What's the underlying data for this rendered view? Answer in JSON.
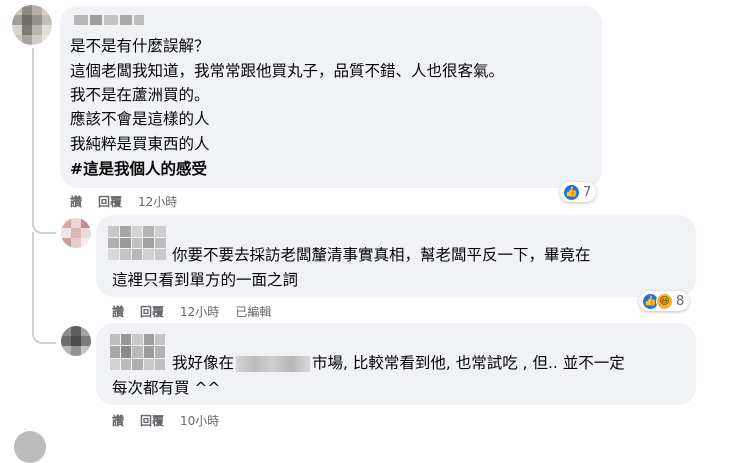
{
  "comments": [
    {
      "lines": [
        "是不是有什麼誤解？",
        "這個老闆我知道，我常常跟他買丸子，品質不錯、人也很客氣。",
        "我不是在蘆洲買的。",
        "應該不會是這樣的人",
        "我純粹是買東西的人"
      ],
      "hashtag": "#這是我個人的感受",
      "actions": {
        "like": "讚",
        "reply": "回覆",
        "time": "12小時"
      },
      "reaction_count": "7"
    },
    {
      "lines": [
        "你要不要去採訪老闆釐清事實真相，幫老闆平反一下，畢竟在",
        "這裡只看到單方的一面之詞"
      ],
      "actions": {
        "like": "讚",
        "reply": "回覆",
        "time": "12小時",
        "edited": "已編輯"
      },
      "reaction_count": "8"
    },
    {
      "line1_prefix": "我好像在",
      "line1_suffix": "市場, 比較常看到他, 也常試吃 , 但.. 並不一定",
      "line2": "每次都有買 ^^",
      "actions": {
        "like": "讚",
        "reply": "回覆",
        "time": "10小時"
      }
    }
  ],
  "icons": {
    "like": "thumbs-up-icon",
    "haha": "laughing-face-icon"
  },
  "colors": {
    "bubble": "#f0f2f5",
    "meta_text": "#65676b",
    "like_blue": "#1b74e4",
    "haha_yellow": "#f7b125"
  }
}
